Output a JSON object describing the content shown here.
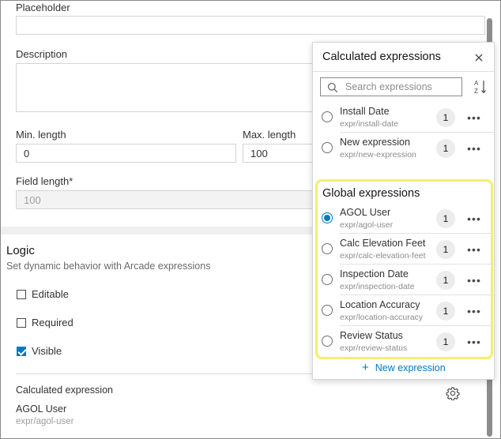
{
  "form": {
    "placeholder_label": "Placeholder",
    "placeholder_value": "",
    "description_label": "Description",
    "min_length_label": "Min. length",
    "min_length_value": "0",
    "max_length_label": "Max. length",
    "max_length_value": "100",
    "field_length_label": "Field length*",
    "field_length_value": "100"
  },
  "logic": {
    "title": "Logic",
    "subtitle": "Set dynamic behavior with Arcade expressions",
    "checkboxes": [
      {
        "label": "Editable",
        "checked": false
      },
      {
        "label": "Required",
        "checked": false
      },
      {
        "label": "Visible",
        "checked": true
      }
    ],
    "calculated_label": "Calculated expression",
    "calculated_name": "AGOL User",
    "calculated_path": "expr/agol-user",
    "settings_icon": "gear-icon"
  },
  "popover": {
    "title": "Calculated expressions",
    "close_icon": "close-icon",
    "search_placeholder": "Search expressions",
    "sort_icon": "sort-az-icon",
    "expressions": [
      {
        "name": "Install Date",
        "path": "expr/install-date",
        "count": "1",
        "selected": false
      },
      {
        "name": "New expression",
        "path": "expr/new-expression",
        "count": "1",
        "selected": false
      }
    ],
    "global_title": "Global expressions",
    "global_expressions": [
      {
        "name": "AGOL User",
        "path": "expr/agol-user",
        "count": "1",
        "selected": true
      },
      {
        "name": "Calc Elevation Feet",
        "path": "expr/calc-elevation-feet",
        "count": "1",
        "selected": false
      },
      {
        "name": "Inspection Date",
        "path": "expr/inspection-date",
        "count": "1",
        "selected": false
      },
      {
        "name": "Location Accuracy",
        "path": "expr/location-accuracy",
        "count": "1",
        "selected": false
      },
      {
        "name": "Review Status",
        "path": "expr/review-status",
        "count": "1",
        "selected": false
      }
    ],
    "new_expression_label": "New expression",
    "more_icon": "•••"
  },
  "colors": {
    "accent": "#0079c1",
    "highlight": "#f3ef6b"
  }
}
